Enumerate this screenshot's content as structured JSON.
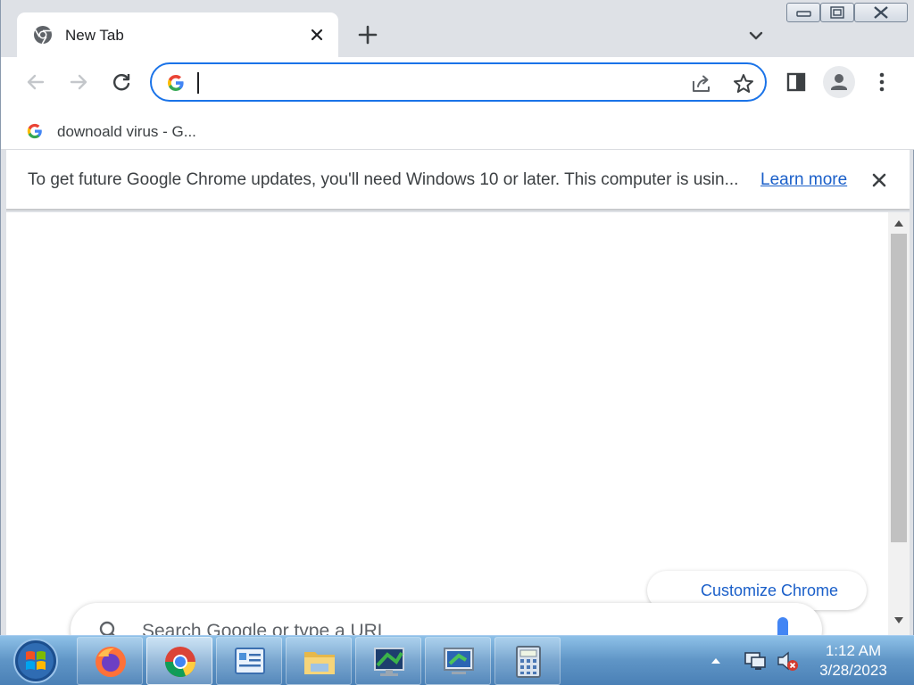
{
  "browser": {
    "tab": {
      "title": "New Tab"
    },
    "omnibox": {
      "value": "",
      "placeholder": ""
    },
    "bookmarks": [
      {
        "label": "downoald virus - G..."
      }
    ],
    "infobar": {
      "message": "To get future Google Chrome updates, you'll need Windows 10 or later. This computer is usin...",
      "link": "Learn more"
    },
    "content": {
      "customize_label": "Customize Chrome",
      "search_placeholder": "Search Google or type a URL"
    }
  },
  "taskbar": {
    "apps": [
      {
        "name": "Firefox",
        "icon": "firefox-icon"
      },
      {
        "name": "Google Chrome",
        "icon": "chrome-icon",
        "active": true
      },
      {
        "name": "Control Panel",
        "icon": "control-panel-icon"
      },
      {
        "name": "Windows Explorer",
        "icon": "folder-icon"
      },
      {
        "name": "Display",
        "icon": "display-icon"
      },
      {
        "name": "Remote Desktop",
        "icon": "remote-desktop-icon"
      },
      {
        "name": "Calculator",
        "icon": "calculator-icon"
      }
    ],
    "clock": {
      "time": "1:12 AM",
      "date": "3/28/2023"
    }
  },
  "colors": {
    "accent": "#1a73e8",
    "link": "#1a5fc9",
    "tabstrip": "#dee1e6"
  }
}
